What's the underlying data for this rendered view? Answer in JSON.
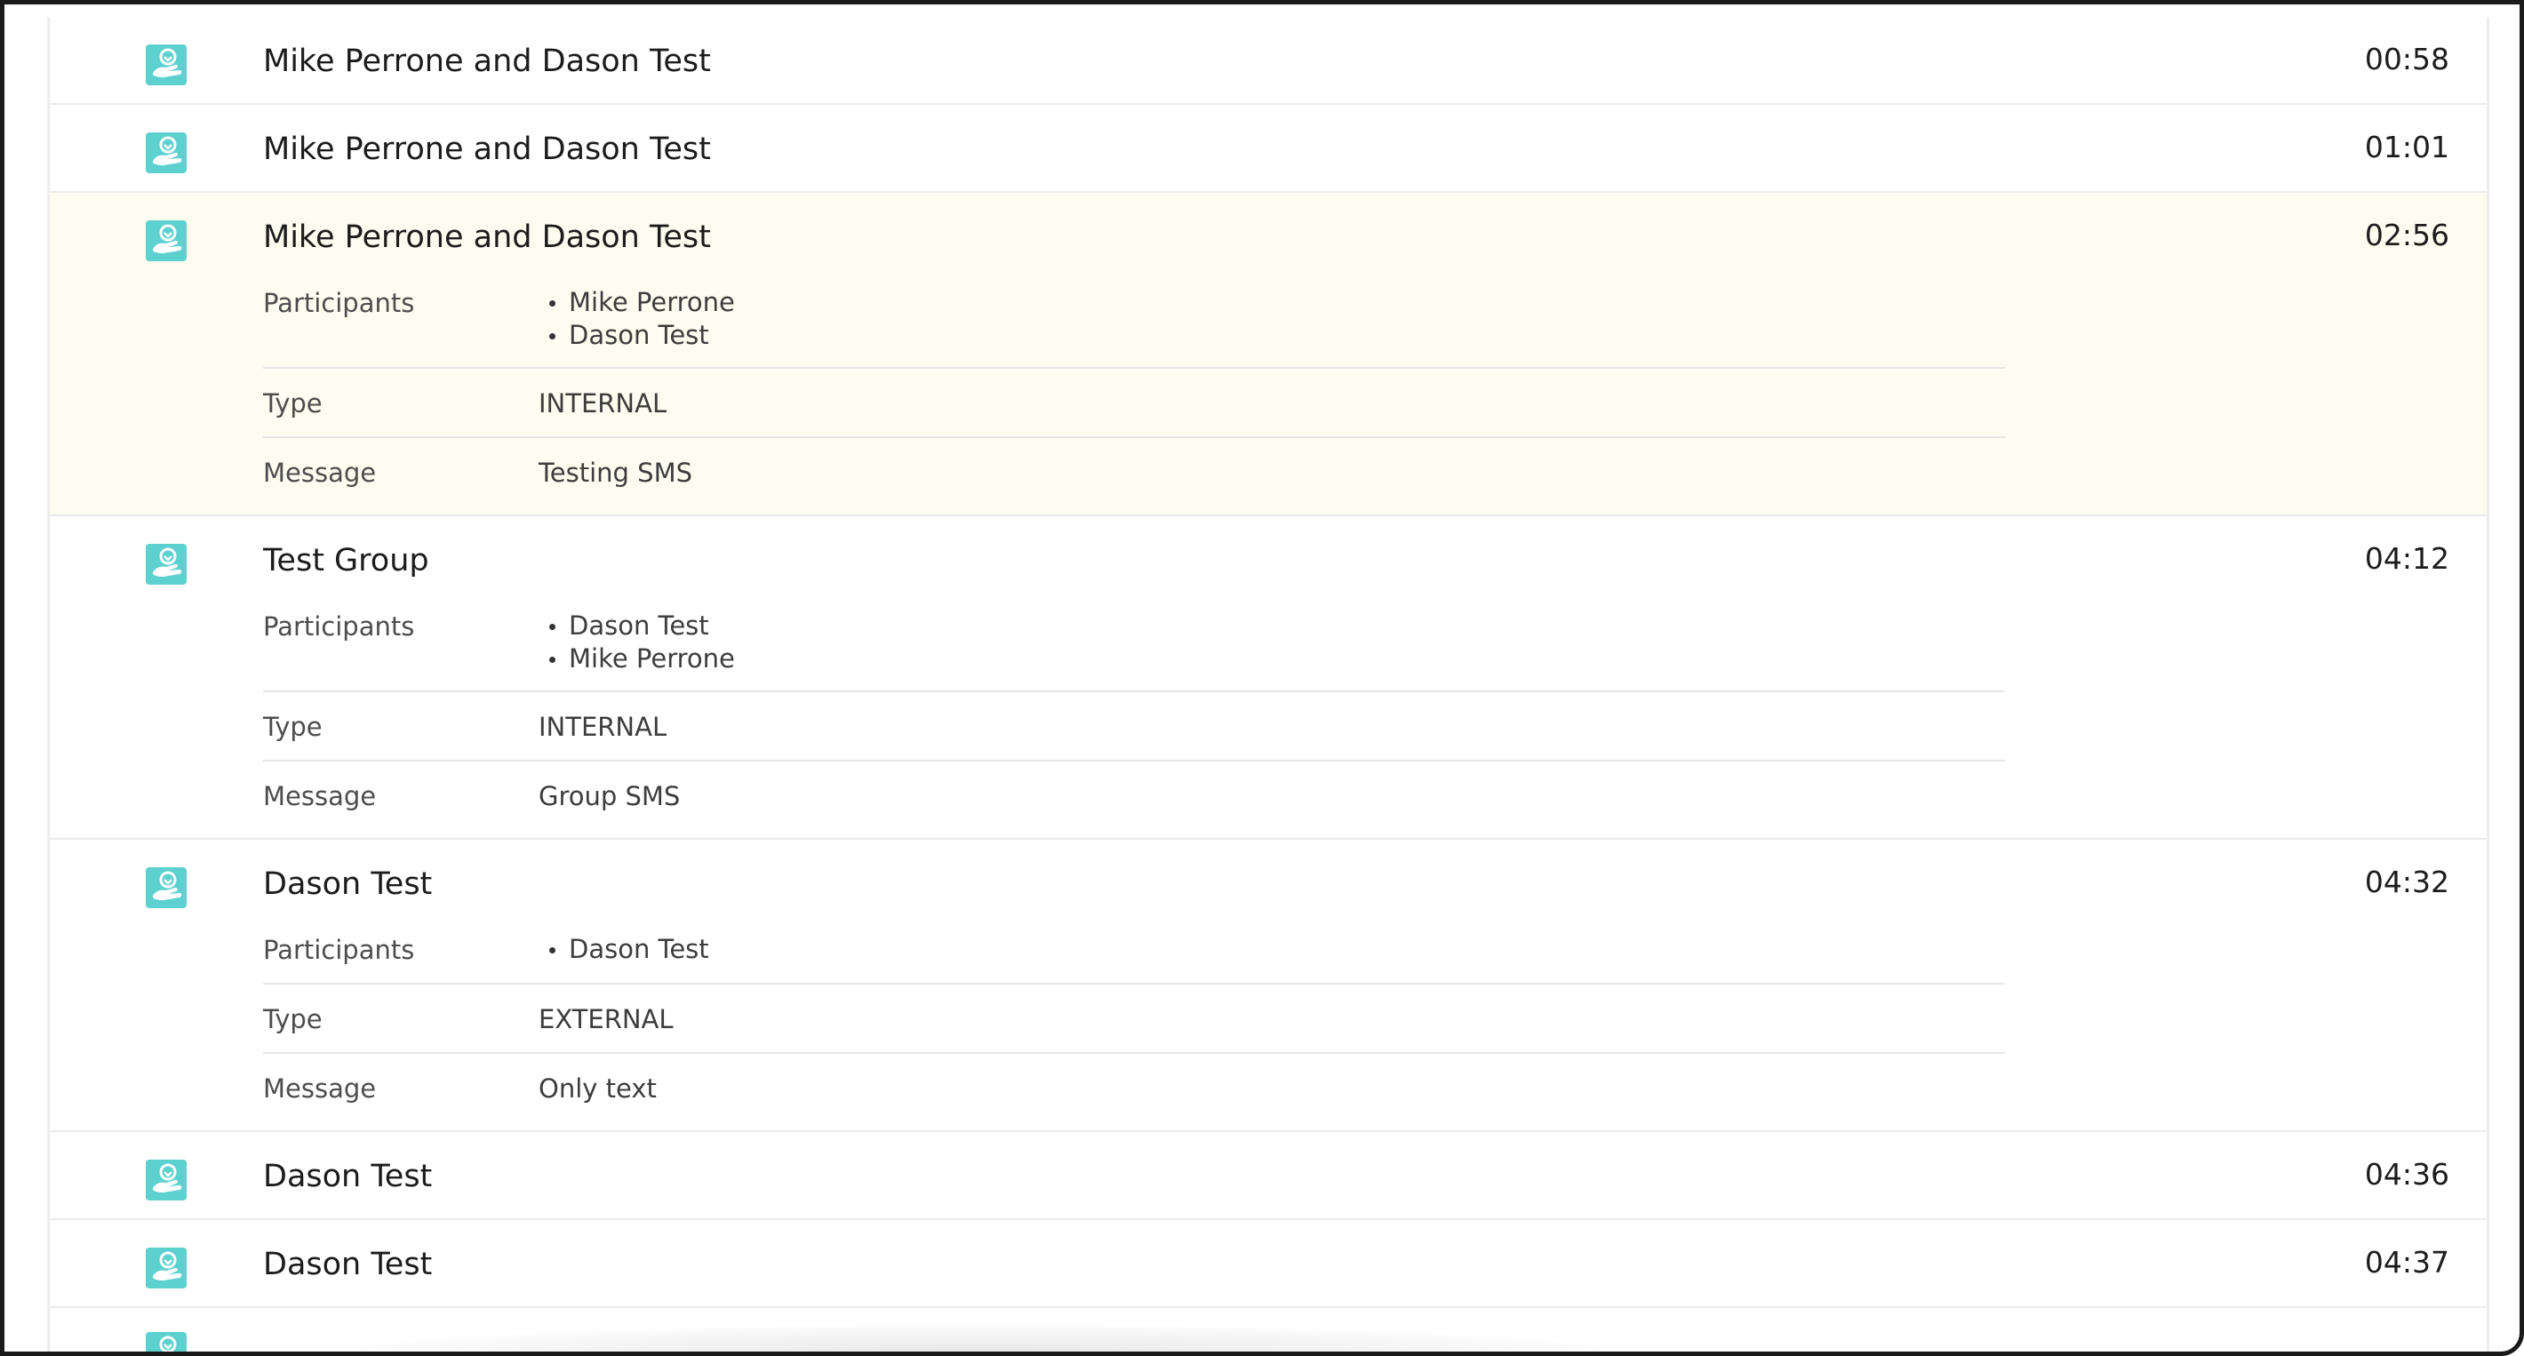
{
  "labels": {
    "participants": "Participants",
    "type": "Type",
    "message": "Message"
  },
  "icon": {
    "name": "sms-message-icon",
    "color": "#5dd1cf"
  },
  "colors": {
    "highlight_row": "#fdfcf0",
    "divider": "#ebebeb"
  },
  "conversations": [
    {
      "title": "Mike Perrone and Dason Test",
      "time": "00:58"
    },
    {
      "title": "Mike Perrone and Dason Test",
      "time": "01:01"
    },
    {
      "title": "Mike Perrone and Dason Test",
      "time": "02:56",
      "participants": [
        "Mike Perrone",
        "Dason Test"
      ],
      "type": "INTERNAL",
      "message": "Testing SMS"
    },
    {
      "title": "Test Group",
      "time": "04:12",
      "participants": [
        "Dason Test",
        "Mike Perrone"
      ],
      "type": "INTERNAL",
      "message": "Group SMS"
    },
    {
      "title": "Dason Test",
      "time": "04:32",
      "participants": [
        "Dason Test"
      ],
      "type": "EXTERNAL",
      "message": "Only text"
    },
    {
      "title": "Dason Test",
      "time": "04:36"
    },
    {
      "title": "Dason Test",
      "time": "04:37"
    }
  ]
}
